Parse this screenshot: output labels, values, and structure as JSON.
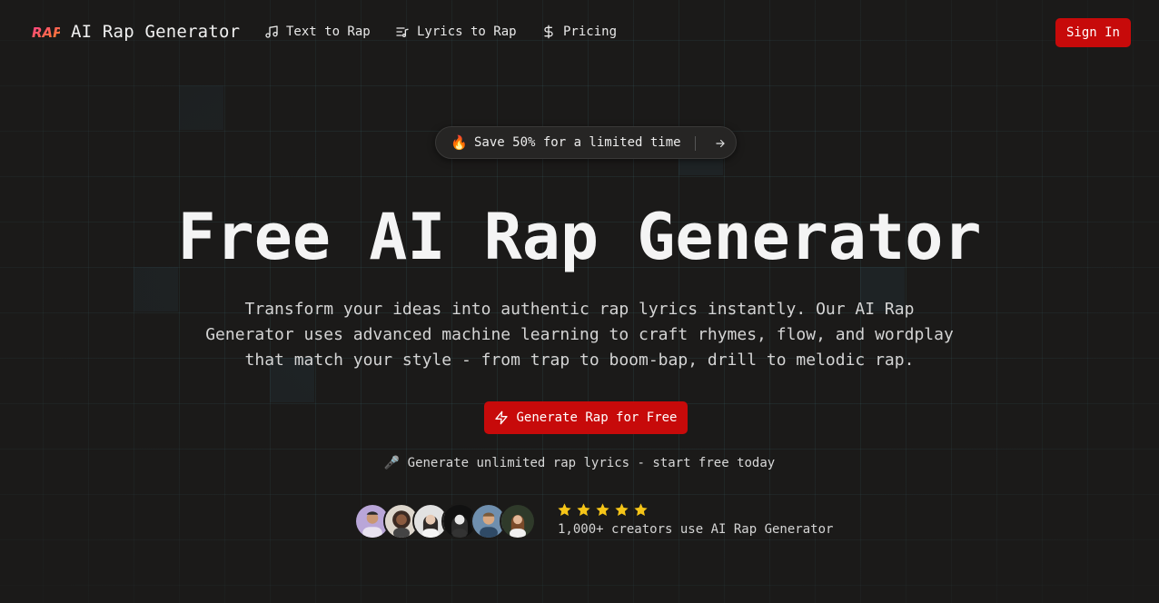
{
  "header": {
    "brand": "AI Rap Generator",
    "logo_text": "RAP",
    "nav": [
      {
        "label": "Text to Rap",
        "icon": "music-note-icon"
      },
      {
        "label": "Lyrics to Rap",
        "icon": "list-music-icon"
      },
      {
        "label": "Pricing",
        "icon": "dollar-icon"
      }
    ],
    "signin_label": "Sign In"
  },
  "promo": {
    "emoji": "🔥",
    "text": "Save 50% for a limited time",
    "icon": "arrow-right-icon"
  },
  "hero": {
    "title": "Free AI Rap Generator",
    "subtitle": "Transform your ideas into authentic rap lyrics instantly. Our AI Rap Generator uses advanced machine learning to craft rhymes, flow, and wordplay that match your style - from trap to boom-bap, drill to melodic rap.",
    "cta_label": "Generate Rap for Free",
    "cta_icon": "lightning-icon",
    "note_emoji": "🎤",
    "note": "Generate unlimited rap lyrics - start free today"
  },
  "social_proof": {
    "rating": 5,
    "rating_max": 5,
    "text": "1,000+ creators use AI Rap Generator",
    "avatar_count": 6
  },
  "colors": {
    "accent": "#c70a0a",
    "background": "#1b1a19",
    "star": "#f5c518"
  }
}
